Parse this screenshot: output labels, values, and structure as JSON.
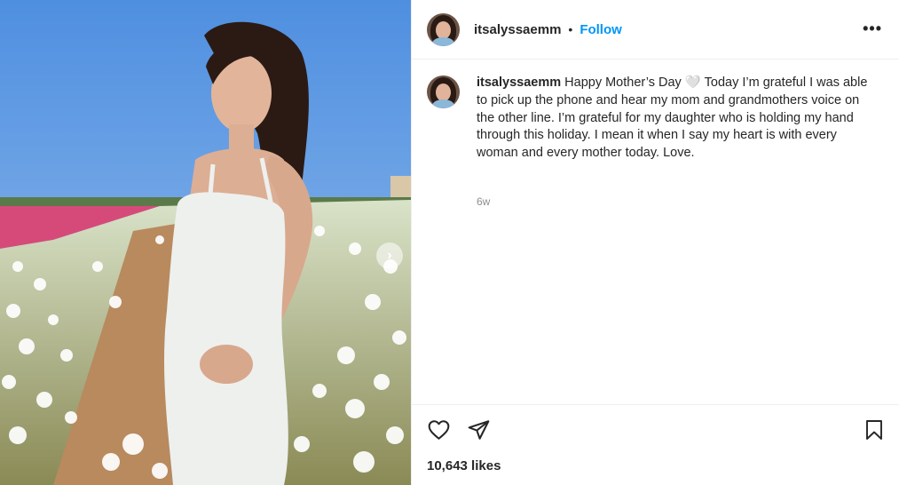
{
  "post": {
    "username": "itsalyssaemm",
    "separator": "•",
    "follow_label": "Follow",
    "more_label": "•••",
    "caption_username": "itsalyssaemm",
    "caption_text": "Happy Mother’s Day 🤍 Today I’m grateful I was able to pick up the phone and hear my mom and grandmothers voice on the other line. I’m grateful for my daughter who is holding my hand through this holiday. I mean it when I say my heart is with every woman and every mother today. Love.",
    "timestamp": "6w",
    "likes": "10,643 likes"
  },
  "colors": {
    "follow_blue": "#0095f6",
    "text": "#262626",
    "muted": "#8e8e8e",
    "divider": "#efefef"
  },
  "icons": {
    "like": "heart-icon",
    "share": "paper-plane-icon",
    "save": "bookmark-icon",
    "more": "more-options-icon"
  }
}
